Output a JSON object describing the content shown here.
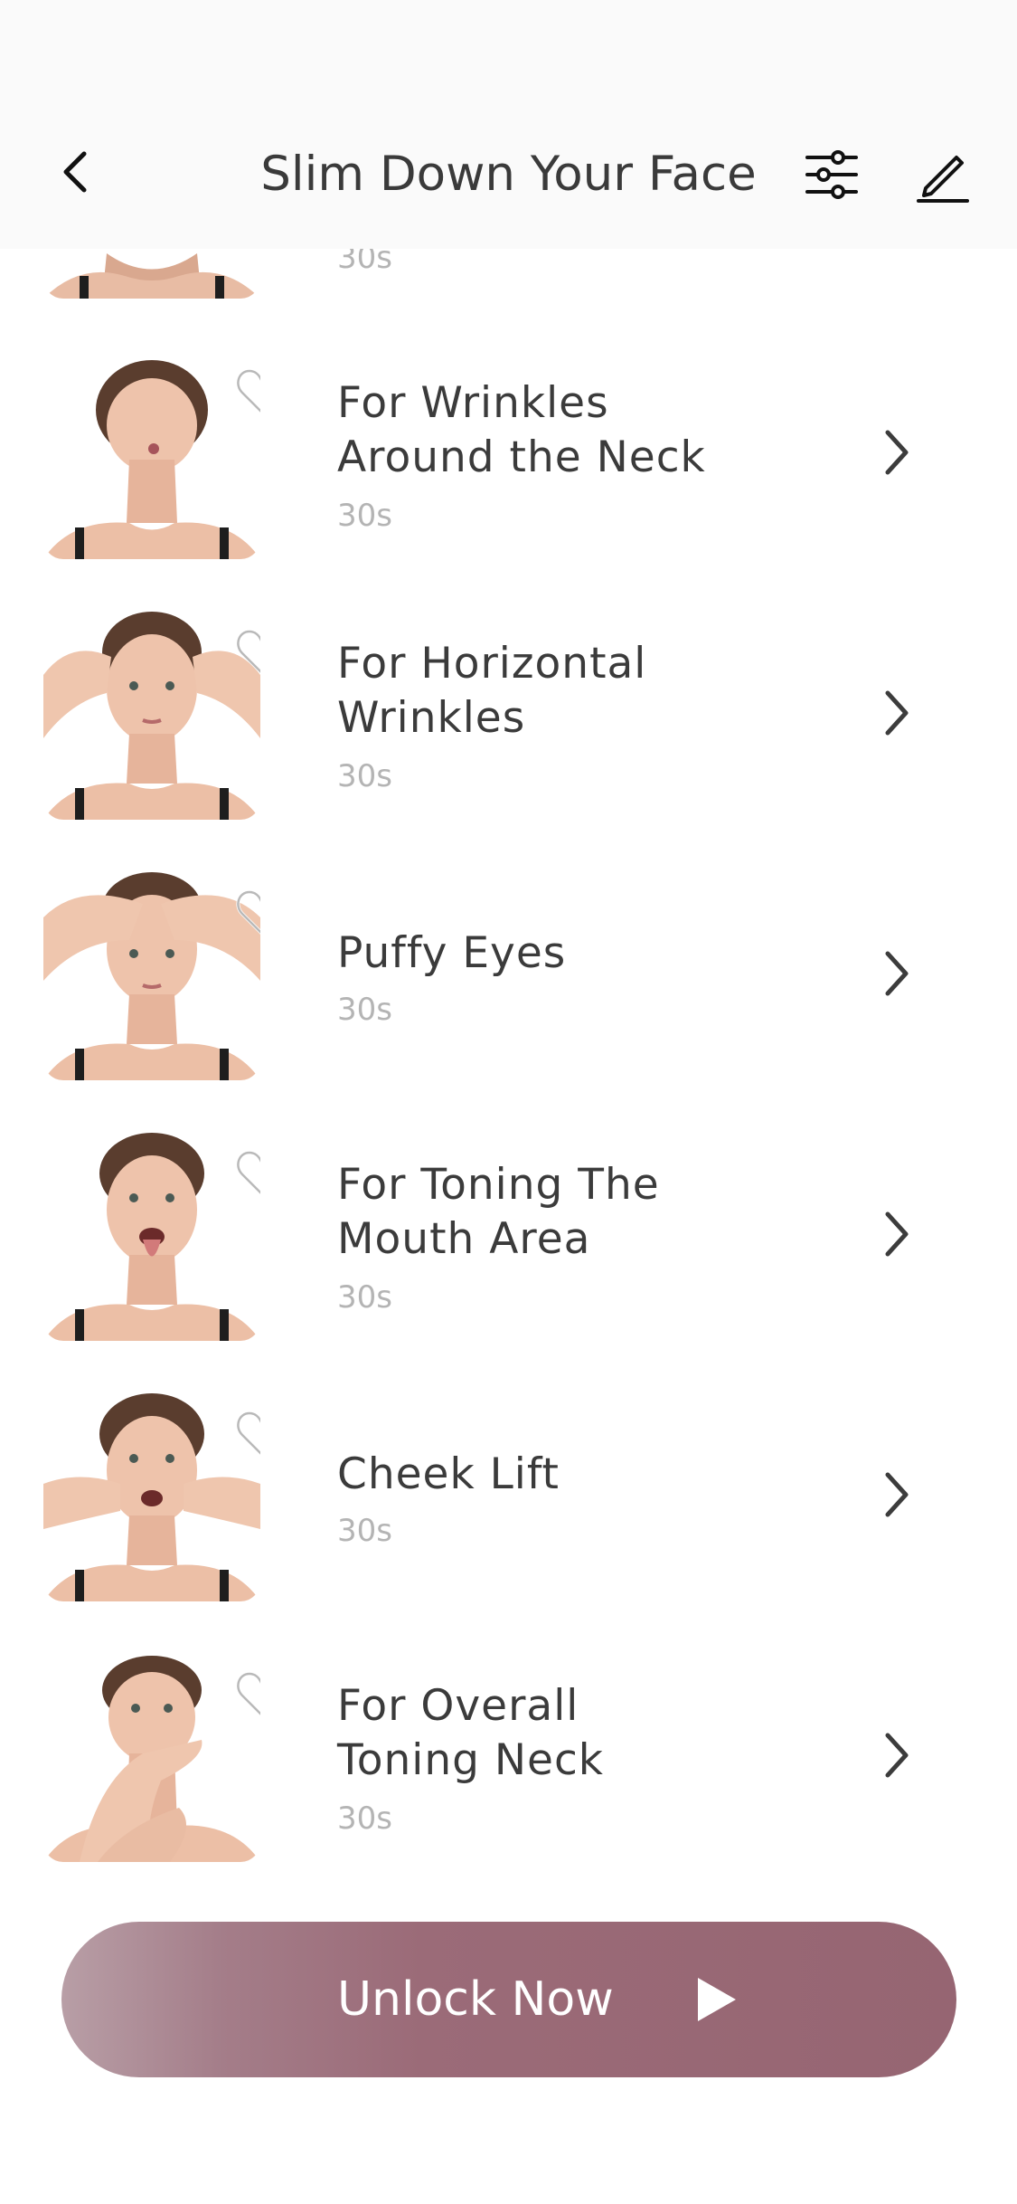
{
  "header": {
    "title": "Slim Down Your Face",
    "icons": [
      "back-arrow-icon",
      "filter-sliders-icon",
      "edit-pencil-icon"
    ]
  },
  "exercises": [
    {
      "title_lines": [
        "",
        ""
      ],
      "duration": "30s",
      "favorite": false
    },
    {
      "title_lines": [
        "For Wrinkles",
        "Around the Neck"
      ],
      "duration": "30s",
      "favorite": false
    },
    {
      "title_lines": [
        "For Horizontal",
        "Wrinkles"
      ],
      "duration": "30s",
      "favorite": false
    },
    {
      "title_lines": [
        "Puffy Eyes",
        ""
      ],
      "duration": "30s",
      "favorite": false
    },
    {
      "title_lines": [
        "For Toning The",
        "Mouth Area"
      ],
      "duration": "30s",
      "favorite": false
    },
    {
      "title_lines": [
        "Cheek Lift",
        ""
      ],
      "duration": "30s",
      "favorite": false
    },
    {
      "title_lines": [
        "For Overall",
        "Toning Neck"
      ],
      "duration": "30s",
      "favorite": false
    }
  ],
  "cta": {
    "label": "Unlock Now",
    "icon": "play-icon",
    "gradient": [
      "#b89ea6",
      "#966572"
    ]
  }
}
